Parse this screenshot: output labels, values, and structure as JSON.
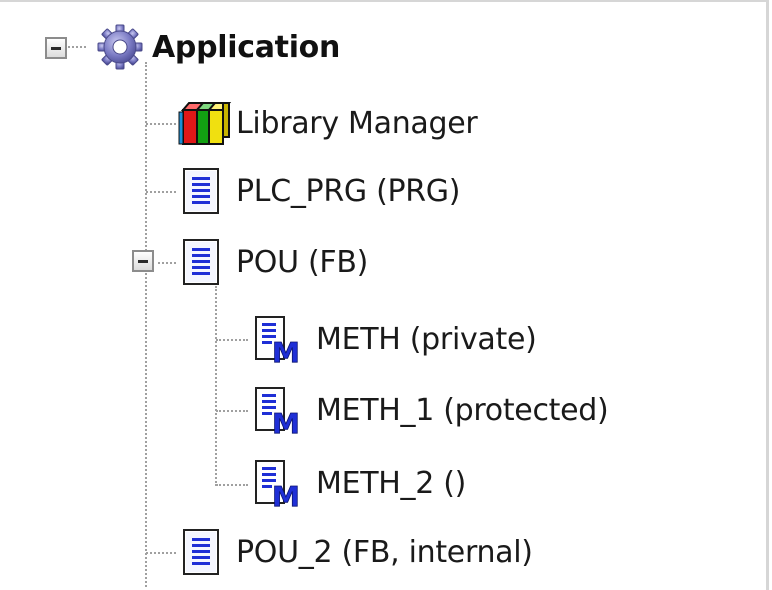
{
  "tree": {
    "root": {
      "label": "Application",
      "icon": "gear-icon",
      "expanded": true
    },
    "items": [
      {
        "label": "Library Manager",
        "icon": "library-books-icon"
      },
      {
        "label": "PLC_PRG (PRG)",
        "icon": "pou-document-icon"
      },
      {
        "label": "POU (FB)",
        "icon": "pou-document-icon",
        "expanded": true,
        "children": [
          {
            "label": "METH (private)",
            "icon": "method-icon"
          },
          {
            "label": "METH_1 (protected)",
            "icon": "method-icon"
          },
          {
            "label": "METH_2 ()",
            "icon": "method-icon"
          }
        ]
      },
      {
        "label": "POU_2 (FB, internal)",
        "icon": "pou-document-icon"
      }
    ]
  },
  "colors": {
    "connector": "#a0a0a0",
    "gear": "#6f6fb8",
    "document_lines": "#1f2fd6",
    "method_letter": "#1f2fd6"
  }
}
